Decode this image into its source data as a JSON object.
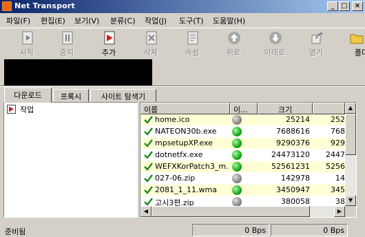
{
  "window": {
    "title": "Net Transport"
  },
  "menu": [
    "파일(F)",
    "편집(E)",
    "보기(V)",
    "분류(C)",
    "작업(J)",
    "도구(T)",
    "도움말(H)"
  ],
  "toolbar": [
    {
      "label": "시작",
      "icon": "play-icon",
      "enabled": false
    },
    {
      "label": "중지",
      "icon": "pause-icon",
      "enabled": false
    },
    {
      "label": "추가",
      "icon": "add-icon",
      "enabled": true
    },
    {
      "label": "삭제",
      "icon": "delete-icon",
      "enabled": false
    },
    {
      "label": "속성",
      "icon": "properties-icon",
      "enabled": false
    },
    {
      "label": "위로",
      "icon": "arrow-up-icon",
      "enabled": false
    },
    {
      "label": "아래로",
      "icon": "arrow-down-icon",
      "enabled": false
    },
    {
      "label": "열기",
      "icon": "open-icon",
      "enabled": false
    },
    {
      "label": "폴더",
      "icon": "folder-icon",
      "enabled": true
    }
  ],
  "tabs": [
    "다운로드",
    "프록시",
    "사이트 탐색기"
  ],
  "tree": {
    "item": "작업"
  },
  "list": {
    "columns": [
      "이름",
      "이...",
      "크기",
      ""
    ],
    "rows": [
      {
        "name": "home.ico",
        "status": "gray",
        "size": "25214",
        "size2": "252"
      },
      {
        "name": "NATEON30b.exe",
        "status": "green",
        "size": "7688616",
        "size2": "768"
      },
      {
        "name": "mpsetupXP.exe",
        "status": "green",
        "size": "9290376",
        "size2": "929"
      },
      {
        "name": "dotnetfx.exe",
        "status": "green",
        "size": "24473120",
        "size2": "2447"
      },
      {
        "name": "WEFXKorPatch3_m...",
        "status": "green",
        "size": "52561231",
        "size2": "5256"
      },
      {
        "name": "027-06.zip",
        "status": "gray",
        "size": "142978",
        "size2": "14"
      },
      {
        "name": "2081_1_11.wma",
        "status": "green",
        "size": "3450947",
        "size2": "345"
      },
      {
        "name": "고시3편.zip",
        "status": "gray",
        "size": "380058",
        "size2": "38"
      }
    ]
  },
  "status": {
    "text": "준비됨",
    "speed1": "0 Bps",
    "speed2": "0 Bps"
  },
  "colors": {
    "row_alt": "#ffffd6",
    "title_start": "#0a246a",
    "check": "#1a8a1a"
  }
}
